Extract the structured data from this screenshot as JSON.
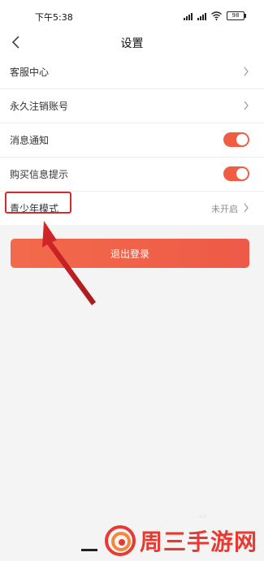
{
  "status_bar": {
    "time": "下午5:38",
    "battery": "98"
  },
  "nav": {
    "title": "设置"
  },
  "settings": {
    "customer_service": "客服中心",
    "delete_account": "永久注销账号",
    "message_notify": "消息通知",
    "purchase_tip": "购买信息提示",
    "youth_mode": "青少年模式",
    "youth_mode_status": "未开启"
  },
  "toggles": {
    "message_notify": true,
    "purchase_tip": true
  },
  "logout_label": "退出登录",
  "watermark": {
    "text": "周三手游网"
  },
  "colors": {
    "accent": "#ef5e43",
    "highlight": "#d72a2a",
    "background": "#f4f4f4"
  }
}
